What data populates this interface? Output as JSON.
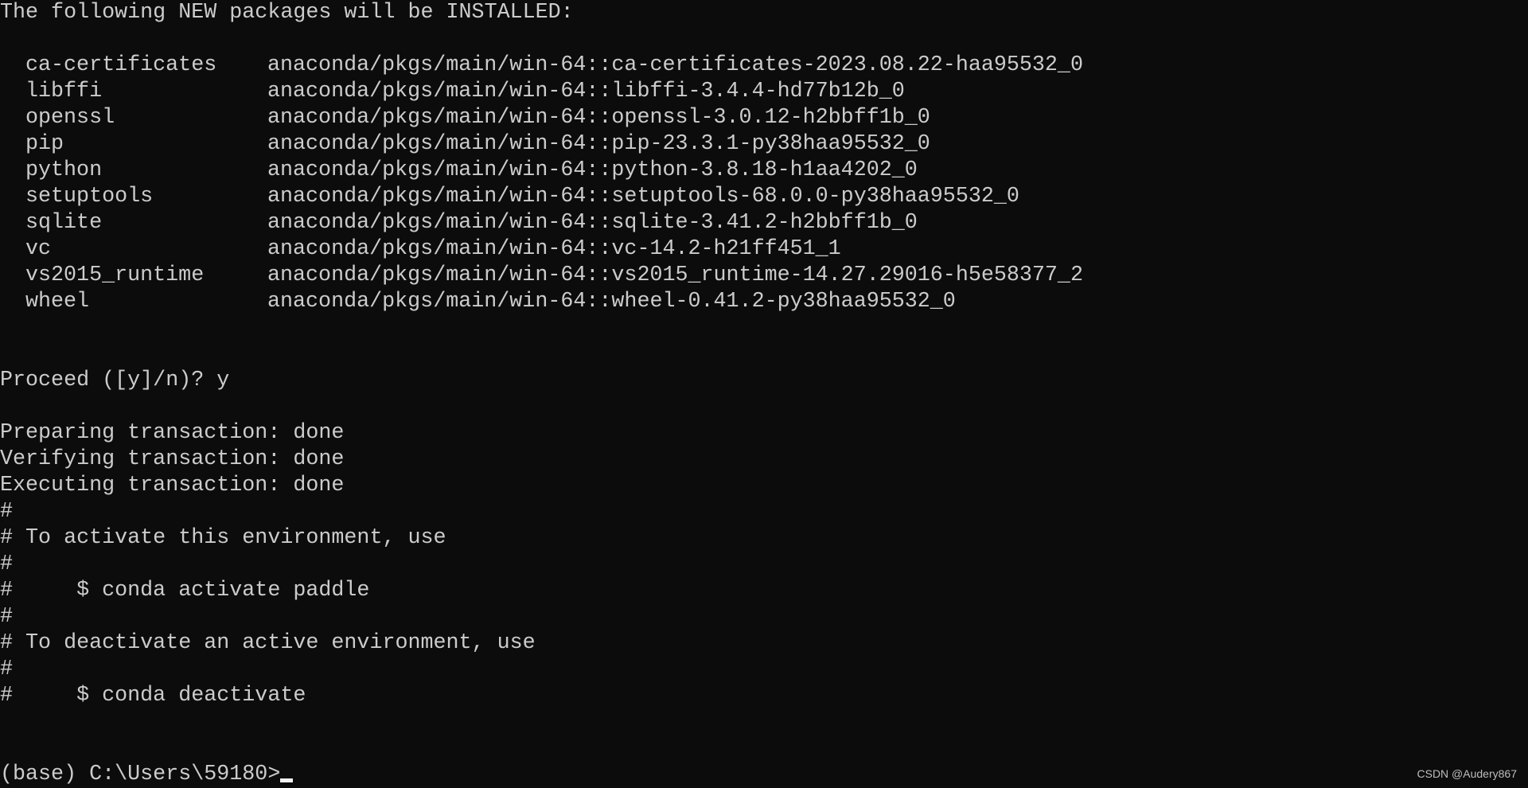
{
  "terminal": {
    "header": "The following NEW packages will be INSTALLED:",
    "packages": [
      {
        "name": "ca-certificates",
        "source": "anaconda/pkgs/main/win-64::ca-certificates-2023.08.22-haa95532_0"
      },
      {
        "name": "libffi",
        "source": "anaconda/pkgs/main/win-64::libffi-3.4.4-hd77b12b_0"
      },
      {
        "name": "openssl",
        "source": "anaconda/pkgs/main/win-64::openssl-3.0.12-h2bbff1b_0"
      },
      {
        "name": "pip",
        "source": "anaconda/pkgs/main/win-64::pip-23.3.1-py38haa95532_0"
      },
      {
        "name": "python",
        "source": "anaconda/pkgs/main/win-64::python-3.8.18-h1aa4202_0"
      },
      {
        "name": "setuptools",
        "source": "anaconda/pkgs/main/win-64::setuptools-68.0.0-py38haa95532_0"
      },
      {
        "name": "sqlite",
        "source": "anaconda/pkgs/main/win-64::sqlite-3.41.2-h2bbff1b_0"
      },
      {
        "name": "vc",
        "source": "anaconda/pkgs/main/win-64::vc-14.2-h21ff451_1"
      },
      {
        "name": "vs2015_runtime",
        "source": "anaconda/pkgs/main/win-64::vs2015_runtime-14.27.29016-h5e58377_2"
      },
      {
        "name": "wheel",
        "source": "anaconda/pkgs/main/win-64::wheel-0.41.2-py38haa95532_0"
      }
    ],
    "proceed": "Proceed ([y]/n)? y",
    "preparing": "Preparing transaction: done",
    "verifying": "Verifying transaction: done",
    "executing": "Executing transaction: done",
    "hash": "#",
    "activate_note": "# To activate this environment, use",
    "activate_cmd": "#     $ conda activate paddle",
    "deactivate_note": "# To deactivate an active environment, use",
    "deactivate_cmd": "#     $ conda deactivate",
    "prompt": "(base) C:\\Users\\59180>"
  },
  "watermark": "CSDN @Audery867",
  "colors": {
    "background": "#0c0c0c",
    "text": "#cccccc"
  }
}
